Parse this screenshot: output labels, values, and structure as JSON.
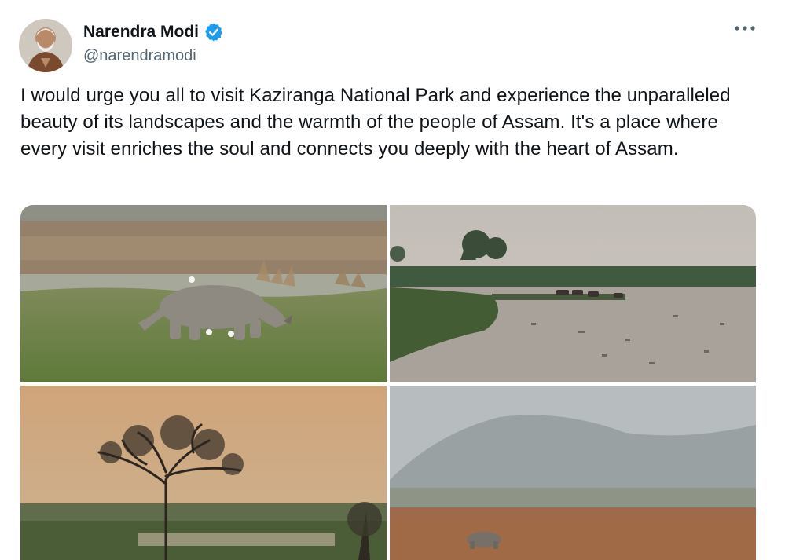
{
  "author": {
    "display_name": "Narendra Modi",
    "handle": "@narendramodi",
    "verified_icon": "verified-badge-icon"
  },
  "menu": {
    "icon": "more-horizontal-icon"
  },
  "tweet": {
    "text": "I would urge you all to visit Kaziranga National Park and experience the unparalleled beauty of its landscapes and the warmth of the people of Assam. It's a place where every visit enriches the soul and connects you deeply with the heart of Assam."
  },
  "media": [
    {
      "subject": "rhino-grassland"
    },
    {
      "subject": "wetland-buffalo"
    },
    {
      "subject": "lone-tree-dusk"
    },
    {
      "subject": "rhino-hazy-plain"
    }
  ],
  "colors": {
    "verified": "#1d9bf0",
    "handle": "#536471",
    "text": "#0f1419"
  }
}
